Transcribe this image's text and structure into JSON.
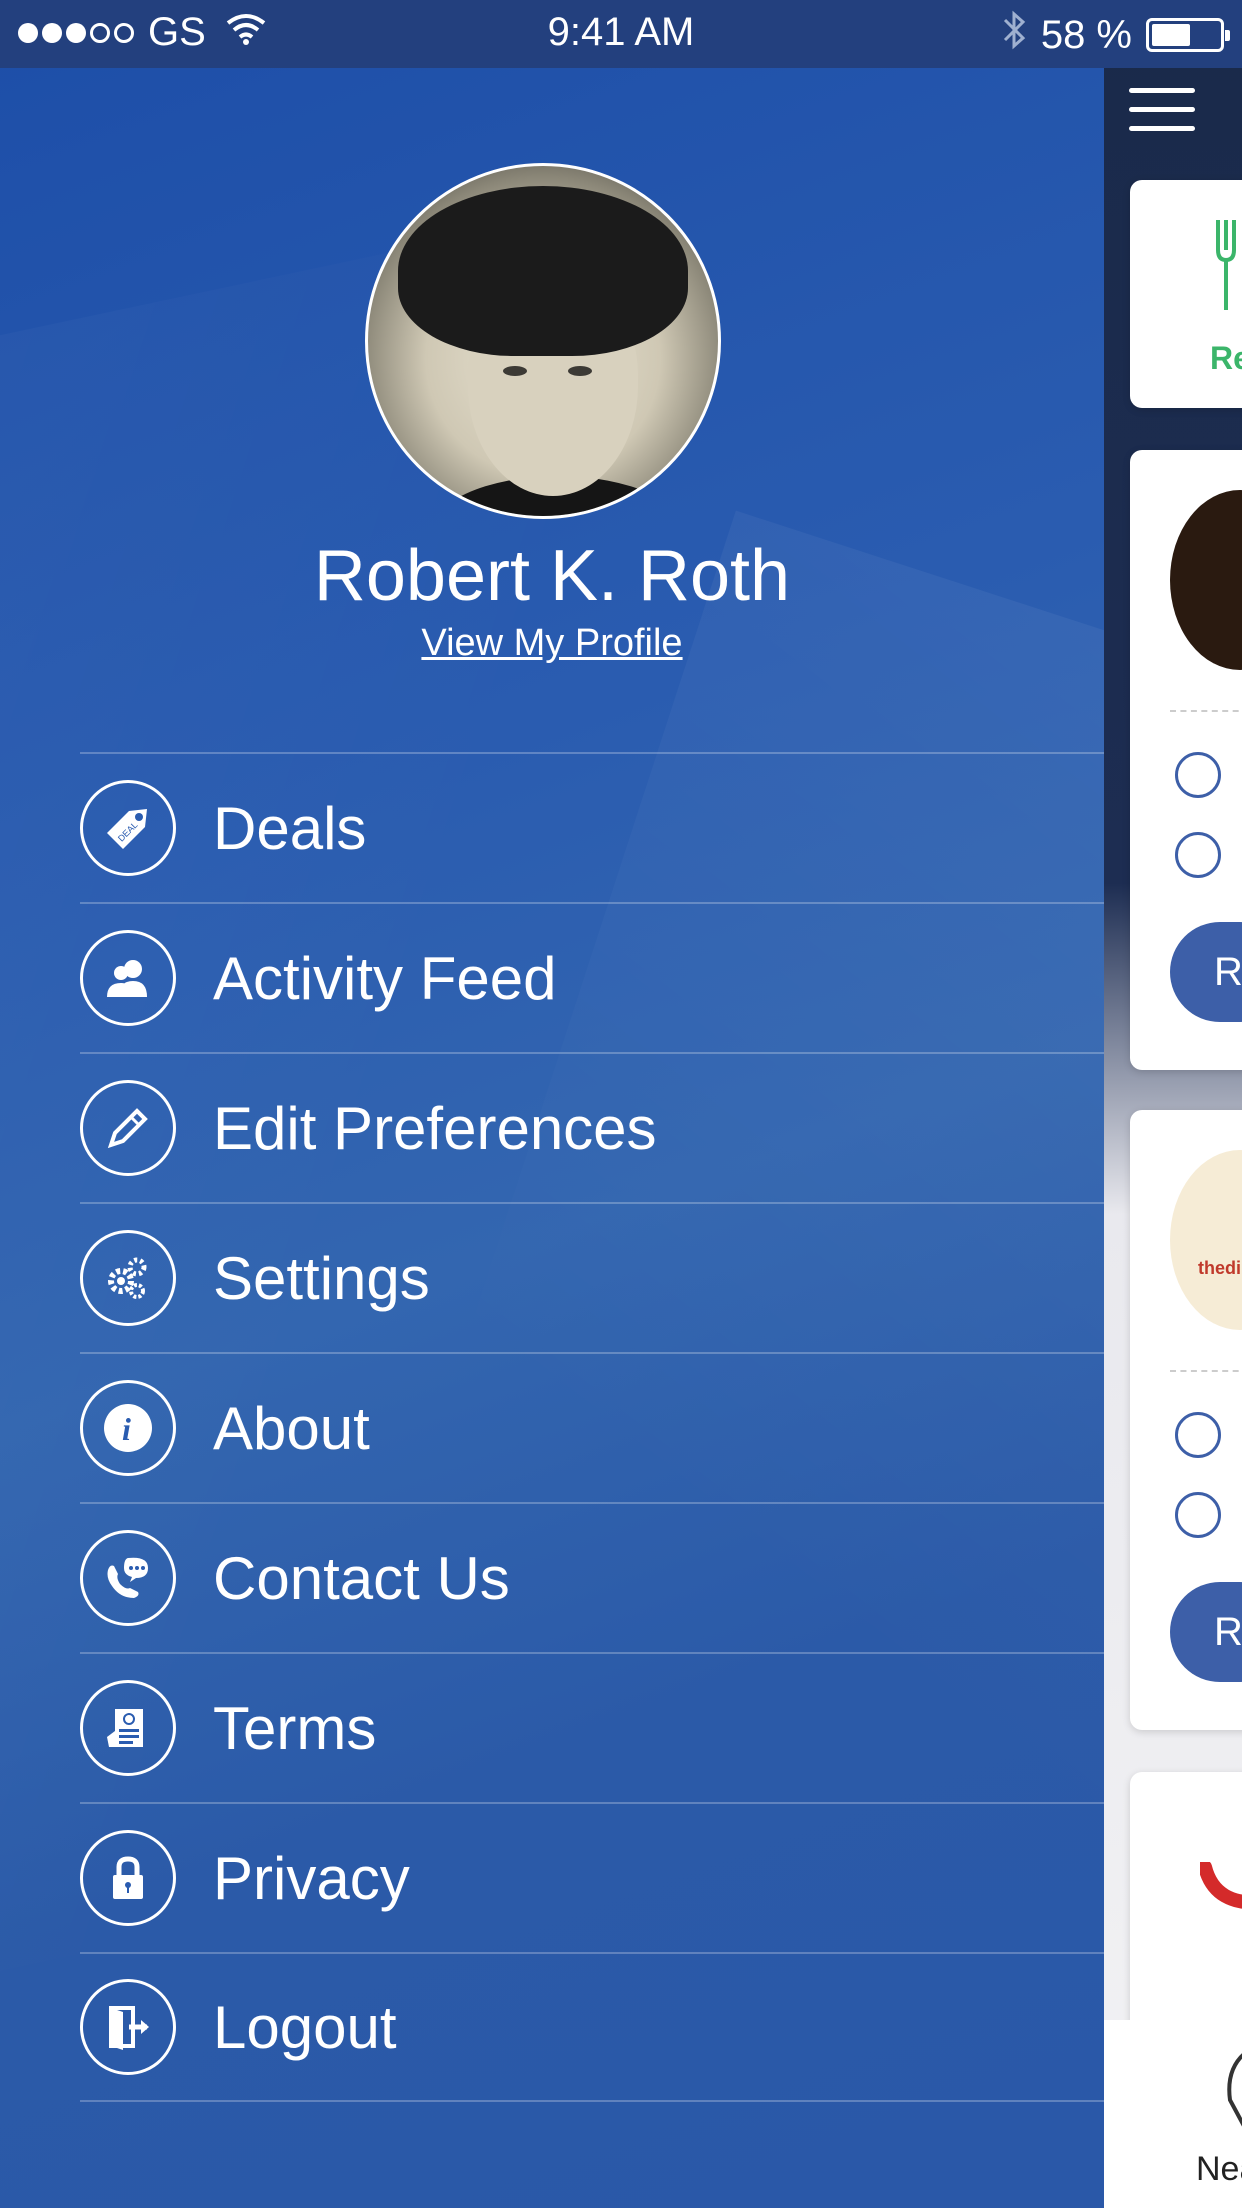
{
  "status_bar": {
    "carrier": "GS",
    "time": "9:41 AM",
    "battery_percent": "58 %",
    "battery_level": 0.58
  },
  "profile": {
    "name": "Robert K. Roth",
    "link": "View My Profile"
  },
  "menu": [
    {
      "label": "Deals",
      "icon": "deal-tag-icon"
    },
    {
      "label": "Activity Feed",
      "icon": "users-icon"
    },
    {
      "label": "Edit Preferences",
      "icon": "pencil-icon"
    },
    {
      "label": "Settings",
      "icon": "gears-icon"
    },
    {
      "label": "About",
      "icon": "info-icon"
    },
    {
      "label": "Contact Us",
      "icon": "phone-chat-icon"
    },
    {
      "label": "Terms",
      "icon": "document-icon"
    },
    {
      "label": "Privacy",
      "icon": "lock-icon"
    },
    {
      "label": "Logout",
      "icon": "logout-door-icon"
    }
  ],
  "background_peek": {
    "category_label": "Re",
    "card_button_label": "R",
    "logo_text": "thedi",
    "tab_label": "Nea"
  },
  "colors": {
    "drawer_bg": "#2a5cb0",
    "status_bar_bg": "#23407e",
    "accent_button": "#3d5fa8",
    "category_green": "#3bb56a"
  }
}
